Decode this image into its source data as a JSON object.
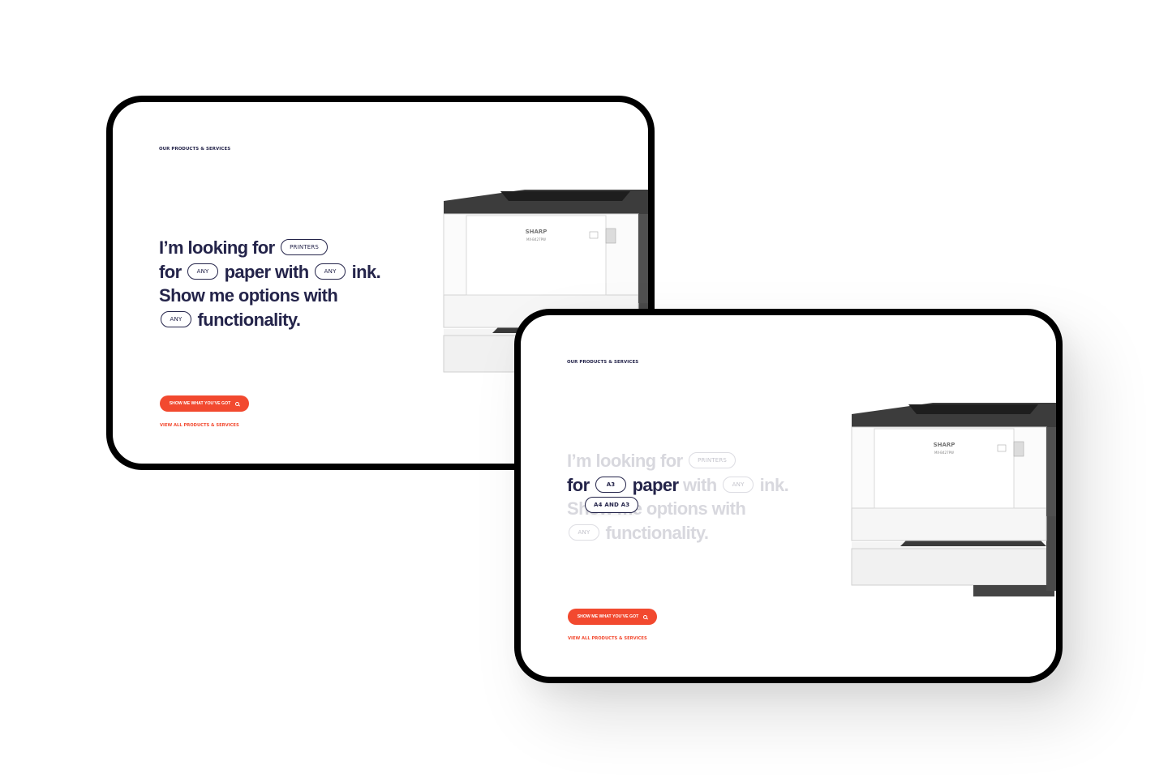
{
  "screens": [
    {
      "id": "back",
      "eyebrow": "OUR PRODUCTS & SERVICES",
      "headline": {
        "line1_text": "I’m looking for",
        "line1_pill": "PRINTERS",
        "line2_for": "for",
        "line2_pill1": "ANY",
        "line2_paper": "paper with",
        "line2_pill2": "ANY",
        "line2_ink": "ink.",
        "line3_text": "Show me options with",
        "line4_pill": "ANY",
        "line4_text": "functionality."
      },
      "cta_label": "SHOW ME WHAT YOU’VE GOT",
      "view_all_label": "VIEW ALL PRODUCTS & SERVICES"
    },
    {
      "id": "front",
      "eyebrow": "OUR PRODUCTS & SERVICES",
      "headline": {
        "line1_text": "I’m looking for",
        "line1_pill": "PRINTERS",
        "line2_for": "for",
        "line2_pill1": "A3",
        "line2_paper": "paper",
        "line2_with": "with",
        "line2_pill2": "ANY",
        "line2_ink": "ink.",
        "line3_text": "Show me options with",
        "line4_pill": "ANY",
        "line4_text": "functionality."
      },
      "dropdown_option": "A4 AND A3",
      "cta_label": "SHOW ME WHAT YOU’VE GOT",
      "view_all_label": "VIEW ALL PRODUCTS & SERVICES"
    }
  ],
  "product": {
    "brand": "SHARP",
    "model": "MX-B427PW"
  },
  "colors": {
    "text_primary": "#24244a",
    "text_faded": "#d8d8de",
    "accent": "#f2492f",
    "frame": "#000000"
  }
}
